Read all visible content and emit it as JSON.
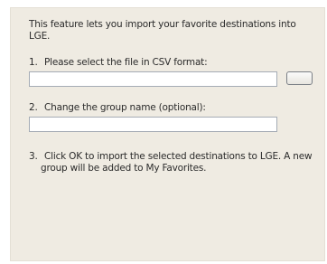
{
  "dialog": {
    "intro_text": "This feature lets you import your favorite destinations into LGE.",
    "step1": {
      "number": "1.",
      "label": "Please select the file in CSV format:",
      "file_value": "",
      "browse_label": ""
    },
    "step2": {
      "number": "2.",
      "label": "Change the group name (optional):",
      "group_value": ""
    },
    "step3": {
      "number": "3.",
      "line1": "Click OK to import the selected destinations to LGE. A new",
      "line2": "group will be added to My Favorites."
    }
  },
  "colors": {
    "panel_background": "#efebe2",
    "text": "#2b2b2b",
    "field_border": "#a5acb5"
  }
}
